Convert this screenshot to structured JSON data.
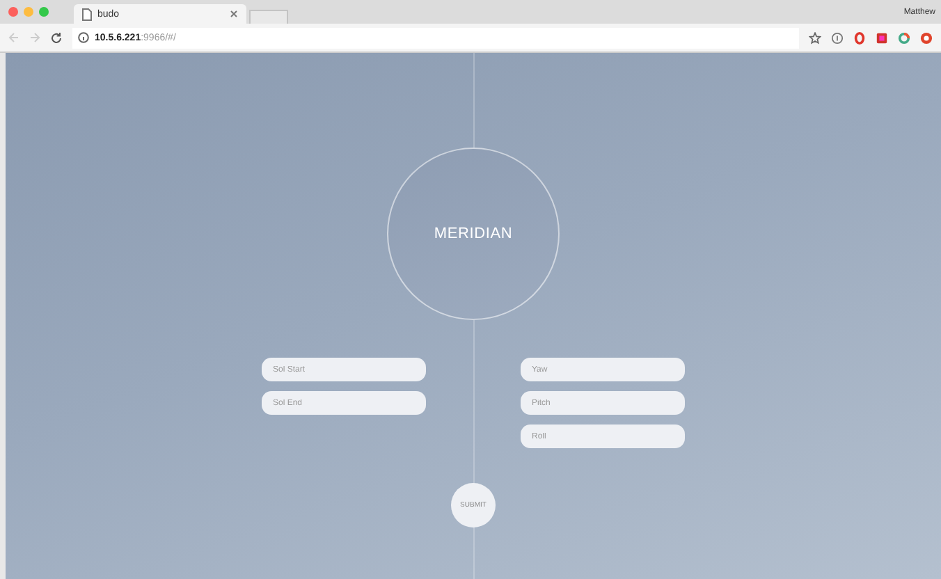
{
  "browser": {
    "tab": {
      "title": "budo"
    },
    "profile": "Matthew",
    "url": {
      "host": "10.5.6.221",
      "path": ":9966/#/"
    }
  },
  "title": "MERIDIAN",
  "left_fields": [
    {
      "placeholder": "Sol Start"
    },
    {
      "placeholder": "Sol End"
    }
  ],
  "right_fields": [
    {
      "placeholder": "Yaw"
    },
    {
      "placeholder": "Pitch"
    },
    {
      "placeholder": "Roll"
    }
  ],
  "submit": "SUBMIT"
}
